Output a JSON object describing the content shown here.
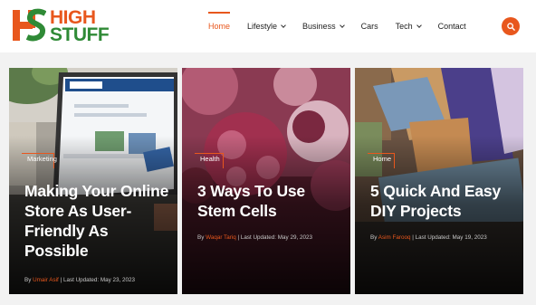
{
  "brand": {
    "name_line1": "HIGH",
    "name_line2": "STUFF",
    "colors": {
      "orange": "#e8571d",
      "green": "#2f8a36"
    }
  },
  "nav": {
    "items": [
      {
        "label": "Home",
        "active": true,
        "dropdown": false
      },
      {
        "label": "Lifestyle",
        "active": false,
        "dropdown": true
      },
      {
        "label": "Business",
        "active": false,
        "dropdown": true
      },
      {
        "label": "Cars",
        "active": false,
        "dropdown": false
      },
      {
        "label": "Tech",
        "active": false,
        "dropdown": true
      },
      {
        "label": "Contact",
        "active": false,
        "dropdown": false
      }
    ],
    "search_icon": "search-icon"
  },
  "articles": [
    {
      "category": "Marketing",
      "title": "Making Your Online Store As User-Friendly As Possible",
      "by": "By",
      "author": "Umair Asif",
      "updated": "| Last Updated: May 23, 2023"
    },
    {
      "category": "Health",
      "title": "3 Ways To Use Stem Cells",
      "by": "By",
      "author": "Waqar Tariq",
      "updated": "| Last Updated: May 29, 2023"
    },
    {
      "category": "Home",
      "title": "5 Quick And Easy DIY Projects",
      "by": "By",
      "author": "Asim Farooq",
      "updated": "| Last Updated: May 19, 2023"
    }
  ]
}
